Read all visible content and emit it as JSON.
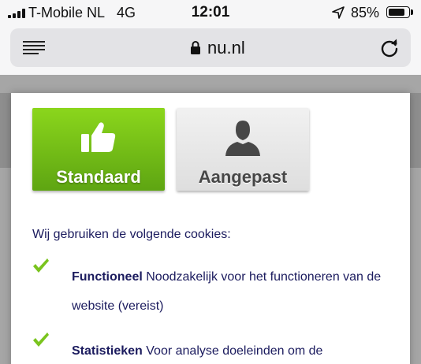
{
  "status_bar": {
    "carrier": "T-Mobile NL",
    "network": "4G",
    "time": "12:01",
    "battery_percent": "85%",
    "battery_level": 0.85
  },
  "browser": {
    "url": "nu.nl",
    "icons": [
      "menu-icon",
      "lock-icon",
      "reload-icon"
    ]
  },
  "cookie_dialog": {
    "options": [
      {
        "label": "Standaard",
        "icon": "thumbs-up-icon",
        "selected": true,
        "color": "#7cc41a"
      },
      {
        "label": "Aangepast",
        "icon": "user-icon",
        "selected": false,
        "color": "#e6e6e6"
      }
    ],
    "intro": "Wij gebruiken de volgende cookies:",
    "cookies": [
      {
        "name": "Functioneel",
        "description": "Noodzakelijk voor het functioneren van de website (vereist)"
      },
      {
        "name": "Statistieken",
        "description": "Voor analyse doeleinden om de"
      }
    ]
  },
  "colors": {
    "accent_green": "#6fb517",
    "text_navy": "#1b1b5e",
    "check_green": "#7ac41e"
  }
}
